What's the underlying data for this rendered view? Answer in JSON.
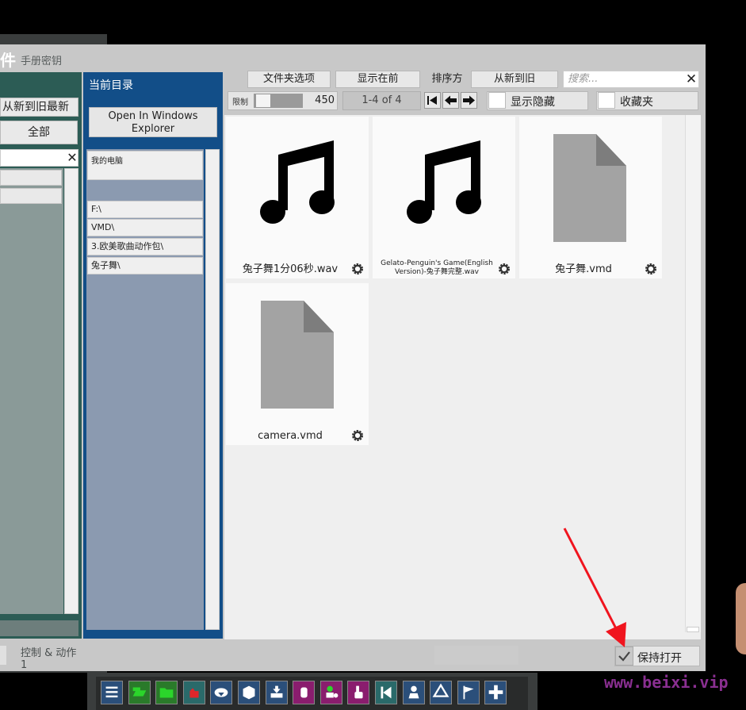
{
  "background": {
    "title_fragment": "件",
    "title_sub": "手册密钥",
    "bottom_label": "控制 & 动作",
    "bottom_label_sub": "1"
  },
  "left_panel": {
    "sort_button": "从新到旧最新",
    "all_button": "全部",
    "search_clear": "✕"
  },
  "middle_panel": {
    "title": "当前目录",
    "open_explorer": "Open In Windows Explorer",
    "my_computer": "我的电脑",
    "paths": [
      "F:\\",
      "VMD\\",
      "3.欧美歌曲动作包\\",
      "兔子舞\\"
    ]
  },
  "toolbar": {
    "folder_options": "文件夹选项",
    "show_first": "显示在前",
    "sort_label": "排序方",
    "sort_value": "从新到旧",
    "search_placeholder": "搜索...",
    "search_clear": "✕",
    "limit_label": "限制",
    "limit_value": "450",
    "limit_fraction": 0.1,
    "page_info": "1-4 of 4",
    "show_hidden": "显示隐藏",
    "favorites": "收藏夹"
  },
  "files": [
    {
      "name": "兔子舞1分06秒.wav",
      "icon": "music-note-icon"
    },
    {
      "name": "Gelato-Penguin's Game(English Version)-兔子舞完整.wav",
      "icon": "music-note-icon"
    },
    {
      "name": "兔子舞.vmd",
      "icon": "file-icon"
    },
    {
      "name": "camera.vmd",
      "icon": "file-icon"
    }
  ],
  "footer": {
    "keep_open": "保持打开",
    "keep_open_checked": true
  },
  "taskbar_icons": [
    {
      "name": "menu-icon",
      "color": "#2b4f7a"
    },
    {
      "name": "open-motion-icon",
      "color": "#2a7a2a"
    },
    {
      "name": "folder-icon",
      "color": "#2a7a2a"
    },
    {
      "name": "red-hand-icon",
      "color": "#2a6a6a"
    },
    {
      "name": "cloud-download-icon",
      "color": "#2b4f7a"
    },
    {
      "name": "box-icon",
      "color": "#2b4f7a"
    },
    {
      "name": "inbox-download-icon",
      "color": "#2b4f7a"
    },
    {
      "name": "hand-icon",
      "color": "#8a1d6e"
    },
    {
      "name": "add-person-icon",
      "color": "#8a1d6e"
    },
    {
      "name": "pointer-hand-icon",
      "color": "#8a1d6e"
    },
    {
      "name": "skip-back-icon",
      "color": "#2a6a6a"
    },
    {
      "name": "person-icon",
      "color": "#2b4f7a"
    },
    {
      "name": "unity-icon",
      "color": "#2b4f7a"
    },
    {
      "name": "flag-icon",
      "color": "#2b4f7a"
    },
    {
      "name": "plus-icon",
      "color": "#2b4f7a"
    }
  ],
  "watermark": "www.beixi.vip"
}
